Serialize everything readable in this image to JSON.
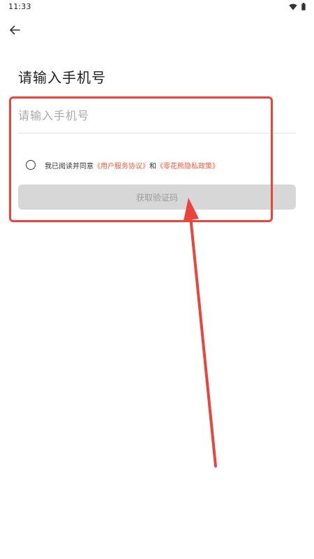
{
  "status_bar": {
    "time": "11:33"
  },
  "icons": {
    "back": "arrow-left-icon",
    "wifi": "wifi-icon",
    "battery": "battery-icon"
  },
  "title": "请输入手机号",
  "phone_input": {
    "value": "",
    "placeholder": "请输入手机号"
  },
  "agreement": {
    "prefix": "我已阅读并同意",
    "link1": "《用户服务协议》",
    "conjunction": "和",
    "link2": "《零花熊隐私政策》"
  },
  "get_code_button": {
    "label": "获取验证码"
  },
  "colors": {
    "link": "#f05a3c",
    "annotation": "#e8453c",
    "button_disabled_bg": "#d7d7d7",
    "button_disabled_text": "#9a9a9a"
  }
}
